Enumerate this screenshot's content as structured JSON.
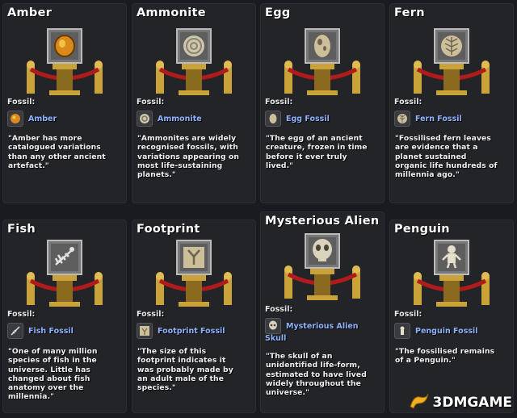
{
  "labels": {
    "fossil": "Fossil:"
  },
  "cards": [
    {
      "title": "Amber",
      "item": "Amber",
      "icon": "amber-icon",
      "description": "\"Amber has more\ncatalogued variations\nthan any other ancient\nartefact.\""
    },
    {
      "title": "Ammonite",
      "item": "Ammonite",
      "icon": "ammonite-icon",
      "description": "\"Ammonites are widely\nrecognised fossils, with\nvariations appearing on\nmost life-sustaining\nplanets.\""
    },
    {
      "title": "Egg",
      "item": "Egg Fossil",
      "icon": "egg-fossil-icon",
      "description": "\"The egg of an ancient\ncreature, frozen in time\nbefore it ever truly\nlived.\""
    },
    {
      "title": "Fern",
      "item": "Fern Fossil",
      "icon": "fern-fossil-icon",
      "description": "\"Fossilised fern leaves\nare evidence that a\nplanet sustained\norganic life hundreds of\nmillennia ago.\""
    },
    {
      "title": "Fish",
      "item": "Fish Fossil",
      "icon": "fish-fossil-icon",
      "description": "\"One of many million\nspecies of fish in the\nuniverse. Little has\nchanged about fish\nanatomy over the\nmillennia.\""
    },
    {
      "title": "Footprint",
      "item": "Footprint Fossil",
      "icon": "footprint-fossil-icon",
      "description": "\"The size of this\nfootprint indicates it\nwas probably made by\nan adult male of the\nspecies.\""
    },
    {
      "title": "Mysterious Alien",
      "item": "Mysterious Alien",
      "item_line2": "Skull",
      "icon": "alien-skull-icon",
      "description": "\"The skull of an\nunidentified life-form,\nestimated to have lived\nwidely throughout the\nuniverse.\""
    },
    {
      "title": "Penguin",
      "item": "Penguin Fossil",
      "icon": "penguin-fossil-icon",
      "description": "\"The fossilised remains\nof a Penguin.\""
    }
  ],
  "watermark": {
    "text": "3DMGAME",
    "icon": "dragon-logo-icon"
  },
  "colors": {
    "item_link": "#8fb3ff",
    "rope": "#b01c1c",
    "brass": "#c9a23a",
    "glass": "#9a9a9a"
  }
}
